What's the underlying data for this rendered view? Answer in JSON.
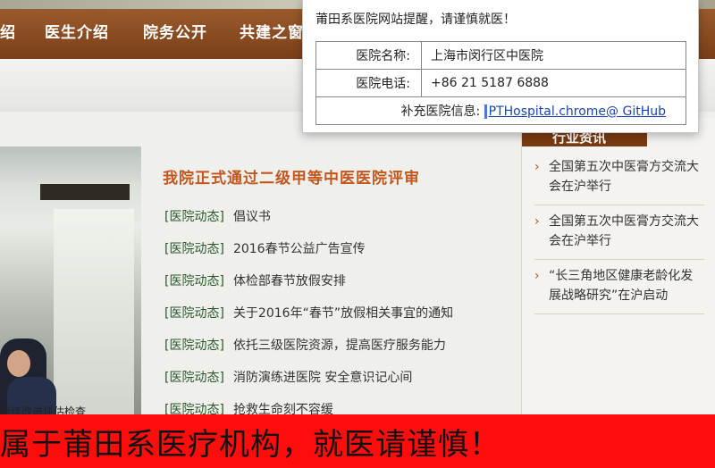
{
  "nav": {
    "items": [
      "绍",
      "医生介绍",
      "院务公开",
      "共建之窗"
    ]
  },
  "photo": {
    "caption": "持续改进评估检查"
  },
  "headline": "我院正式通过二级甲等中医医院评审",
  "news": [
    {
      "category": "[医院动态]",
      "title": "倡议书"
    },
    {
      "category": "[医院动态]",
      "title": "2016春节公益广告宣传"
    },
    {
      "category": "[医院动态]",
      "title": "体检部春节放假安排"
    },
    {
      "category": "[医院动态]",
      "title": "关于2016年“春节”放假相关事宜的通知"
    },
    {
      "category": "[医院动态]",
      "title": "依托三级医院资源，提高医疗服务能力"
    },
    {
      "category": "[医院动态]",
      "title": "消防演练进医院 安全意识记心间"
    },
    {
      "category": "[医院动态]",
      "title": "抢救生命刻不容缓"
    }
  ],
  "sidebar": {
    "tab": "行业资讯",
    "items": [
      "全国第五次中医膏方交流大会在沪举行",
      "全国第五次中医膏方交流大会在沪举行",
      "“长三角地区健康老龄化发展战略研究”在沪启动"
    ]
  },
  "popup": {
    "warning": "莆田系医院网站提醒，请谨慎就医！",
    "name_label": "医院名称:",
    "name_value": "上海市闵行区中医院",
    "phone_label": "医院电话:",
    "phone_value": "+86 21 5187 6888",
    "extra_label": "补充医院信息:",
    "link_text": "PTHospital.chrome@ GitHub"
  },
  "banner": "属于莆田系医疗机构，就医请谨慎！",
  "colors": {
    "nav_brown": "#8a4a22",
    "headline_orange": "#c4571d",
    "category_green": "#2a5a2a",
    "banner_red": "#ff0d0d",
    "link_blue": "#1a44b4"
  }
}
